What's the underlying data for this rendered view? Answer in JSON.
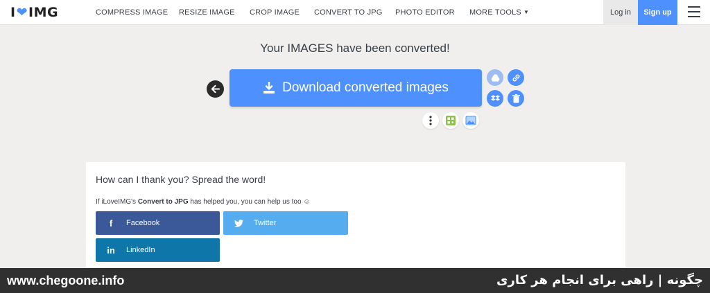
{
  "header": {
    "logo": {
      "left": "I",
      "right": "IMG"
    },
    "nav": [
      {
        "label": "COMPRESS IMAGE"
      },
      {
        "label": "RESIZE IMAGE"
      },
      {
        "label": "CROP IMAGE"
      },
      {
        "label": "CONVERT TO JPG"
      },
      {
        "label": "PHOTO EDITOR"
      },
      {
        "label": "MORE TOOLS"
      }
    ],
    "login_label": "Log in",
    "signup_label": "Sign up"
  },
  "main": {
    "title": "Your IMAGES have been converted!",
    "download_label": "Download converted images"
  },
  "share": {
    "title": "How can I thank you? Spread the word!",
    "text_before": "If iLoveIMG's ",
    "tool_name": "Convert to JPG",
    "text_after": " has helped you, you can help us too ☺",
    "buttons": [
      {
        "icon": "facebook-icon",
        "glyph": "f",
        "label": "Facebook"
      },
      {
        "icon": "twitter-icon",
        "glyph": "t",
        "label": "Twitter"
      },
      {
        "icon": "linkedin-icon",
        "glyph": "in",
        "label": "LinkedIn"
      }
    ]
  },
  "watermark": {
    "site": "www.chegoone.info",
    "tagline": "چگونه | راهی برای انجام هر کاری"
  },
  "colors": {
    "primary": "#4d90fe",
    "facebook": "#3b5998",
    "twitter": "#55acee",
    "linkedin": "#0e76a8",
    "background": "#f0efed"
  }
}
